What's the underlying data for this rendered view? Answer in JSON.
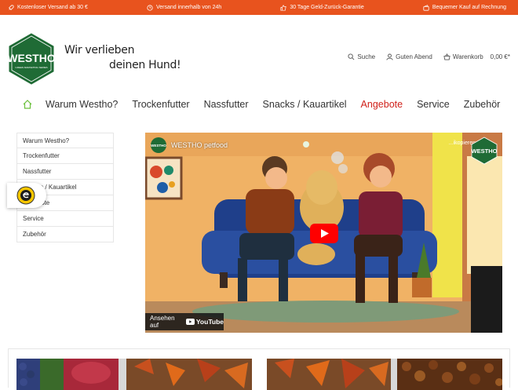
{
  "topbar": {
    "items": [
      {
        "icon": "rocket-icon",
        "label": "Kostenloser Versand ab 30 €"
      },
      {
        "icon": "clock-icon",
        "label": "Versand innerhalb von 24h"
      },
      {
        "icon": "thumbs-up-icon",
        "label": "30 Tage Geld-Zurück-Garantie"
      },
      {
        "icon": "wallet-icon",
        "label": "Bequemer Kauf auf Rechnung"
      }
    ]
  },
  "header": {
    "logo_text": "WESTHO",
    "logo_subtext": "GREEN MARKETING SERIES",
    "slogan_line1": "Wir verlieben",
    "slogan_line2": "deinen Hund!",
    "search_label": "Suche",
    "account_label": "Guten Abend",
    "cart_label": "Warenkorb",
    "cart_total": "0,00 €*"
  },
  "nav": {
    "items": [
      "Warum Westho?",
      "Trockenfutter",
      "Nassfutter",
      "Snacks / Kauartikel",
      "Angebote",
      "Service",
      "Zubehör"
    ],
    "active": "Angebote"
  },
  "sidebar": {
    "items": [
      "Warum Westho?",
      "Trockenfutter",
      "Nassfutter",
      "Snacks / Kauartikel",
      "Angebote",
      "Service",
      "Zubehör"
    ]
  },
  "video": {
    "title": "WESTHO petfood",
    "topright": "...ikopieren",
    "watch_on": "Ansehen auf",
    "platform": "YouTube",
    "logo_text": "WESTHO"
  },
  "colors": {
    "topbar": "#e8531e",
    "accent": "#d0201a",
    "brand_green": "#1f6b35"
  }
}
